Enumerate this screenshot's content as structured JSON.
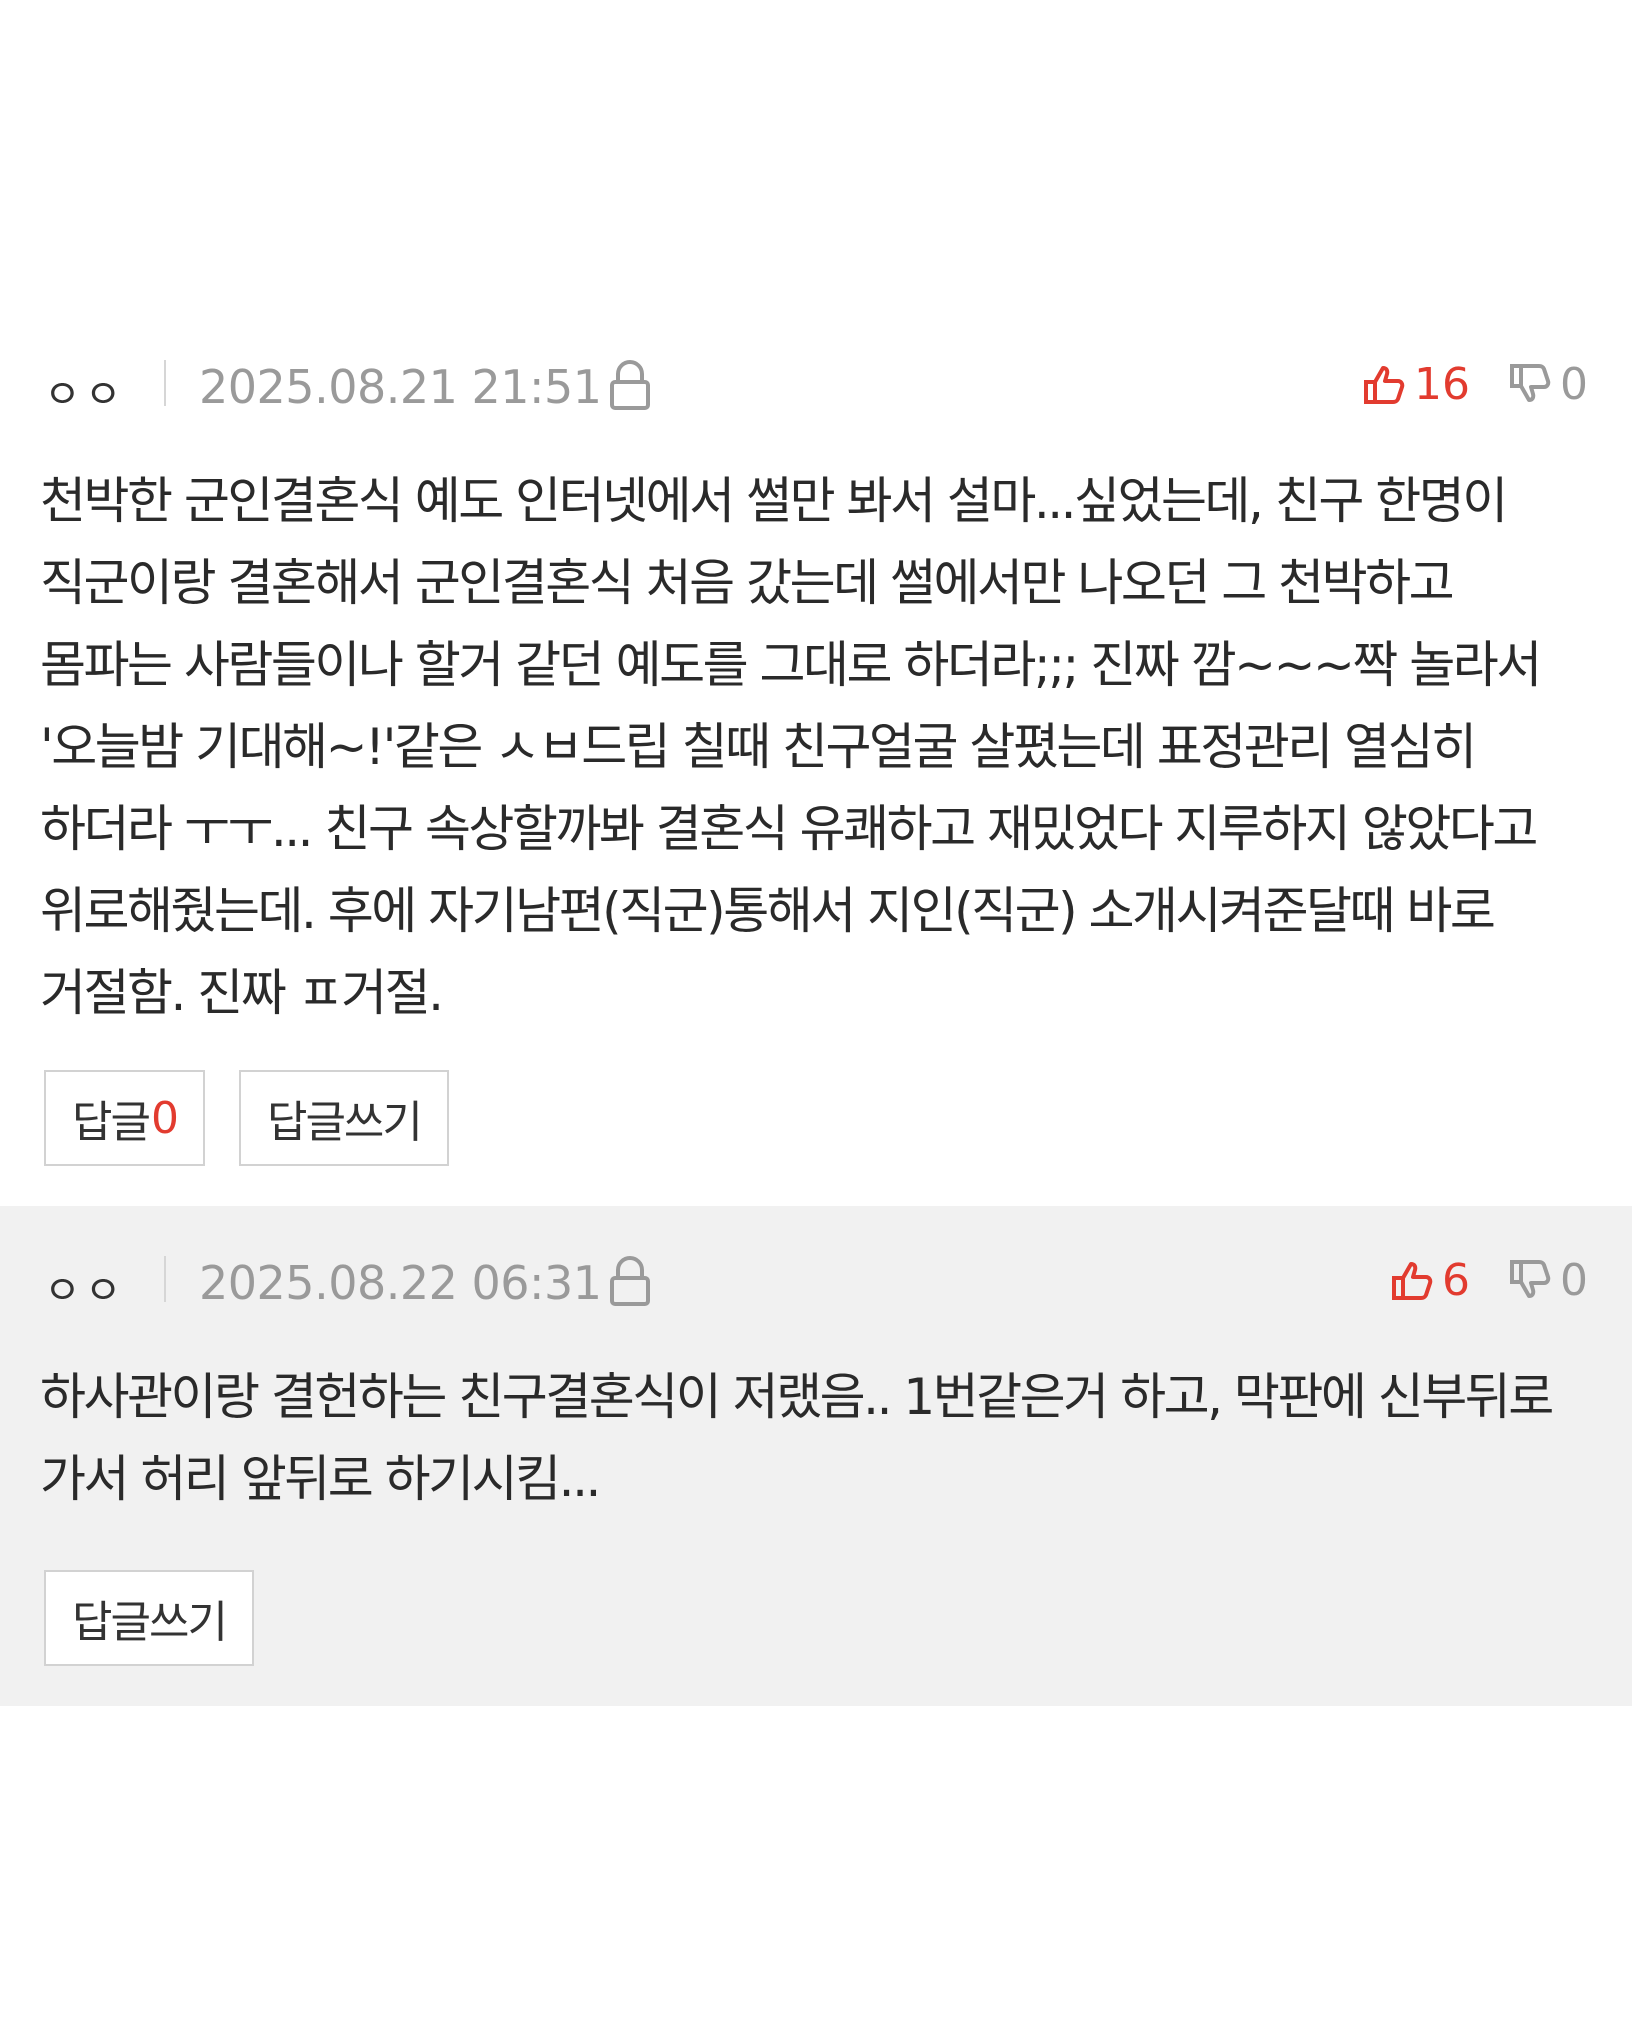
{
  "comments": [
    {
      "author": "ㅇㅇ",
      "date": "2025.08.21 21:51",
      "likes": "16",
      "dislikes": "0",
      "text": "천박한 군인결혼식 예도 인터넷에서 썰만 봐서 설마...싶었는데, 친구 한명이 직군이랑 결혼해서 군인결혼식 처음 갔는데 썰에서만 나오던 그 천박하고 몸파는 사람들이나 할거 같던 예도를 그대로 하더라;;; 진짜 깜~~~짝 놀라서 '오늘밤 기대해~!'같은 ㅅㅂ드립 칠때 친구얼굴 살폈는데 표정관리 열심히 하더라 ㅜㅜ... 친구 속상할까봐 결혼식 유쾌하고 재밌었다 지루하지 않았다고 위로해줬는데. 후에 자기남편(직군)통해서 지인(직군) 소개시켜준달때 바로 거절함. 진짜 ㅍ거절.",
      "reply_label": "답글",
      "reply_count": "0",
      "write_reply_label": "답글쓰기",
      "lock_icon": "lock-icon"
    },
    {
      "author": "ㅇㅇ",
      "date": "2025.08.22 06:31",
      "likes": "6",
      "dislikes": "0",
      "text": "하사관이랑 결헌하는 친구결혼식이 저랬음.. 1번같은거 하고, 막판에 신부뒤로 가서 허리 앞뒤로 하기시킴...",
      "write_reply_label": "답글쓰기",
      "lock_icon": "lock-icon"
    }
  ],
  "colors": {
    "accent_red": "#e23b2f",
    "muted_gray": "#9a9a9a",
    "second_comment_bg": "#f1f1f1"
  }
}
